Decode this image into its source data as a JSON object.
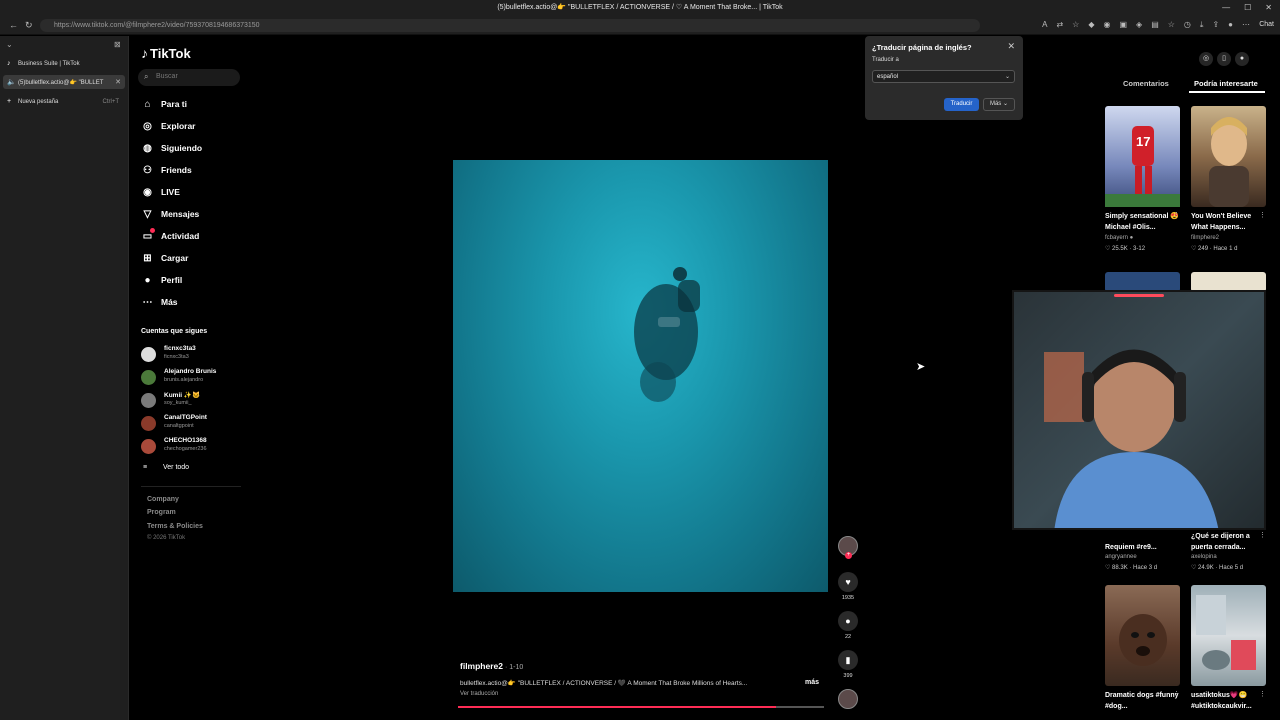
{
  "browser": {
    "window_title": "(5)bulletflex.actio@👉 \"BULLETFLEX / ACTIONVERSE / ♡ A Moment That Broke... | TikTok",
    "url": "https://www.tiktok.com/@filmphere2/video/7593708194686373150",
    "chat_label": "Chat",
    "tabs": [
      {
        "label": "Business Suite | TikTok",
        "active": false
      },
      {
        "label": "(5)bulletflex.actio@👉 \"BULLET",
        "active": true
      }
    ],
    "new_tab": {
      "label": "Nueva pestaña",
      "shortcut": "Ctrl+T"
    }
  },
  "tiktok": {
    "logo": "TikTok",
    "search_placeholder": "Buscar",
    "nav": [
      {
        "label": "Para ti",
        "icon": "home-icon"
      },
      {
        "label": "Explorar",
        "icon": "compass-icon"
      },
      {
        "label": "Siguiendo",
        "icon": "following-icon"
      },
      {
        "label": "Friends",
        "icon": "friends-icon"
      },
      {
        "label": "LIVE",
        "icon": "live-icon"
      },
      {
        "label": "Mensajes",
        "icon": "send-icon"
      },
      {
        "label": "Actividad",
        "icon": "inbox-icon"
      },
      {
        "label": "Cargar",
        "icon": "upload-icon"
      },
      {
        "label": "Perfil",
        "icon": "profile-icon"
      },
      {
        "label": "Más",
        "icon": "more-icon"
      }
    ],
    "following_title": "Cuentas que sigues",
    "accounts": [
      {
        "name": "ficnxc3ta3",
        "handle": "ficnxc3ta3"
      },
      {
        "name": "Alejandro Brunis",
        "handle": "brunis.alejandro"
      },
      {
        "name": "Kumii ✨🐱",
        "handle": "soy_kumii_"
      },
      {
        "name": "CanalTGPoint",
        "handle": "canaltgpoint"
      },
      {
        "name": "CHECHO1368",
        "handle": "chechogamer236"
      }
    ],
    "see_all": "Ver todo",
    "footer": [
      "Company",
      "Program",
      "Terms & Policies"
    ],
    "copyright": "© 2026 TikTok"
  },
  "video": {
    "author": "filmphere2",
    "date": " · 1-10",
    "caption": "bulletflex.actio@👉 \"BULLETFLEX / ACTIONVERSE / 🖤 A Moment That Broke Millions of Hearts...",
    "more": "más",
    "see_translation": "Ver traducción",
    "progress": 0.87,
    "likes": "1935",
    "comments": "22",
    "saves": "399"
  },
  "translate_popup": {
    "title": "¿Traducir página de inglés?",
    "label": "Traducir a",
    "language": "español",
    "translate_button": "Traducir",
    "more_button": "Más"
  },
  "right_panel": {
    "tabs": [
      "Comentarios",
      "Podría interesarte"
    ],
    "active_tab": "Podría interesarte",
    "cards": [
      {
        "title": "Simply sensational 😍 Michael #Olis...",
        "author": "fcbayern ●",
        "stats": "♡ 25.5K · 3-12"
      },
      {
        "title": "You Won't Believe What Happens...",
        "author": "filmphere2",
        "stats": "♡ 249 · Hace 1 d"
      },
      {
        "title": "Requiem #re9...",
        "author": "angryannee",
        "stats": "♡ 88.3K · Hace 3 d"
      },
      {
        "title": "¿Qué se dijeron a puerta cerrada...",
        "author": "axelopina",
        "stats": "♡ 24.9K · Hace 5 d"
      },
      {
        "title": "Dramatic dogs #funny #dog...",
        "author": "",
        "stats": ""
      },
      {
        "title": "usatiktokus💗😁 #uktiktokcaukvir...",
        "author": "",
        "stats": ""
      }
    ]
  },
  "colors": {
    "accent": "#fe2c55",
    "translate_blue": "#2563c9",
    "video_teal": "#1a97ad"
  }
}
